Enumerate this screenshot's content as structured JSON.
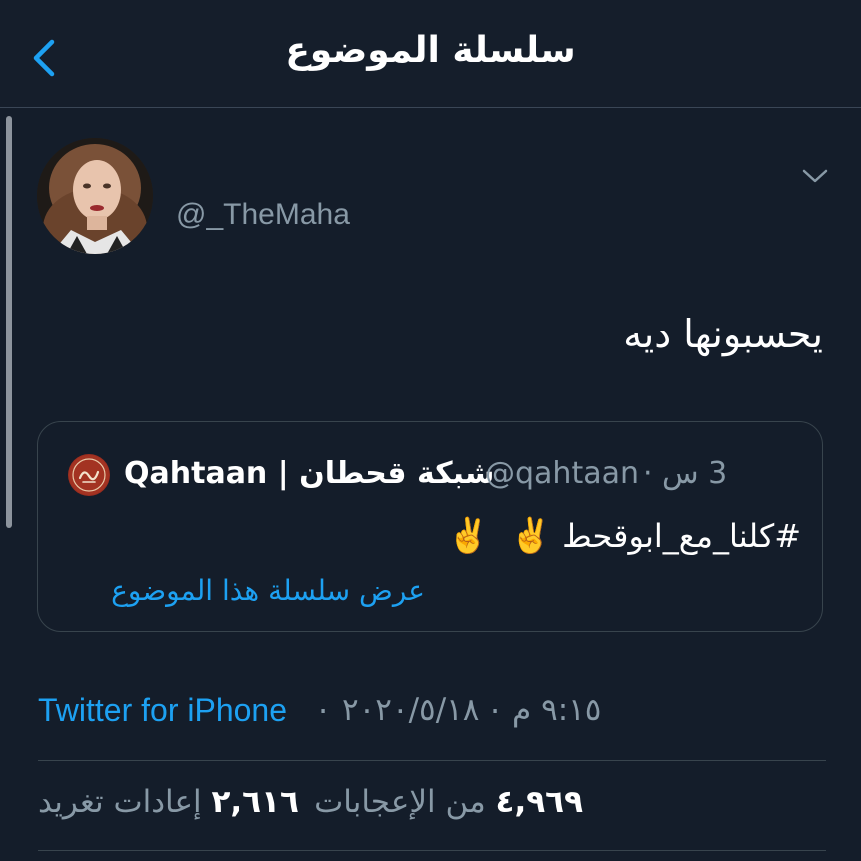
{
  "header": {
    "title": "سلسلة الموضوع",
    "back_icon": "chevron-left-icon"
  },
  "tweet": {
    "username": "@_TheMaha",
    "text": "يحسبونها ديه",
    "caret_icon": "chevron-down-icon"
  },
  "quote": {
    "name": "Qahtaan | شبكة قحطان",
    "handle": "@qahtaan",
    "dot": "·",
    "time": "3 س",
    "body": "#كلنا_مع_ابوقحط",
    "emoji": "✌️",
    "thread_link": "عرض سلسلة هذا الموضوع"
  },
  "meta": {
    "time": "٩:١٥ م",
    "date": "٢٠٢٠/٥/١٨",
    "separator": "·",
    "source": "Twitter for iPhone"
  },
  "stats": {
    "likes_count": "٤,٩٦٩",
    "likes_label": "من الإعجابات",
    "retweets_count": "٢,٦١٦",
    "retweets_label": "إعادات تغريد"
  },
  "colors": {
    "background": "#141d2a",
    "link": "#1da1f2",
    "secondary_text": "#8899a6",
    "border": "#38444d"
  }
}
